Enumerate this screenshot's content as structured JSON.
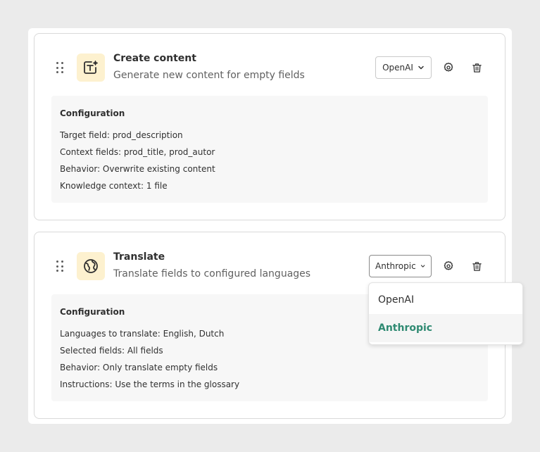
{
  "cards": [
    {
      "title": "Create content",
      "subtitle": "Generate new content for empty fields",
      "icon": "text-sparkle-icon",
      "provider": "OpenAI",
      "config_heading": "Configuration",
      "config_lines": [
        "Target field: prod_description",
        "Context fields: prod_title, prod_autor",
        "Behavior: Overwrite existing content",
        "Knowledge context: 1 file"
      ]
    },
    {
      "title": "Translate",
      "subtitle": "Translate fields to configured languages",
      "icon": "globe-icon",
      "provider": "Anthropic",
      "config_heading": "Configuration",
      "config_lines": [
        "Languages to translate: English, Dutch",
        "Selected fields: All fields",
        "Behavior: Only translate empty fields",
        "Instructions: Use the terms in the glossary"
      ]
    }
  ],
  "provider_dropdown": {
    "options": [
      "OpenAI",
      "Anthropic"
    ],
    "selected": "Anthropic"
  },
  "colors": {
    "icon_tile_bg": "#fdf1cf",
    "selected_option": "#2f8a72",
    "config_bg": "#f7f7f7"
  }
}
